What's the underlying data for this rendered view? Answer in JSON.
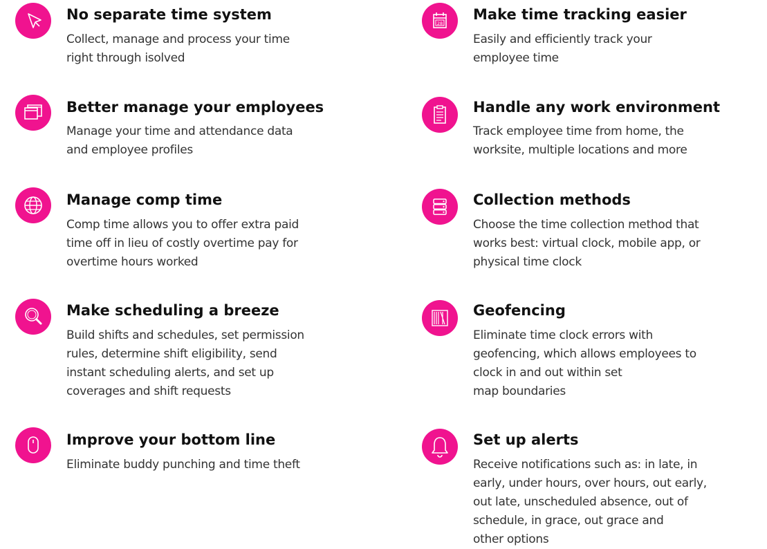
{
  "accent_color": "#f0138f",
  "features": [
    {
      "icon": "cursor-arrow-icon",
      "title": "No separate time system",
      "desc_lines": [
        "Collect, manage and process your time",
        "right through isolved"
      ]
    },
    {
      "icon": "stacked-windows-icon",
      "title": "Better manage your employees",
      "desc_lines": [
        "Manage your time and attendance data",
        "and employee profiles"
      ]
    },
    {
      "icon": "globe-icon",
      "title": "Manage comp time",
      "desc_lines": [
        "Comp time allows you to offer extra paid",
        "time off in lieu of costly overtime pay for",
        "overtime hours worked"
      ]
    },
    {
      "icon": "magnifier-icon",
      "title": "Make scheduling a breeze",
      "desc_lines": [
        "Build shifts and schedules, set permission",
        "rules, determine shift eligibility, send",
        "instant scheduling alerts, and set up",
        "coverages and shift requests"
      ]
    },
    {
      "icon": "mouse-icon",
      "title": "Improve your bottom line",
      "desc_lines": [
        "Eliminate buddy punching and time theft"
      ]
    },
    {
      "icon": "calendar-icon",
      "calendar_day": "28",
      "title": "Make time tracking easier",
      "desc_lines": [
        "Easily and efficiently track your",
        "employee time"
      ]
    },
    {
      "icon": "clipboard-icon",
      "title": "Handle any work environment",
      "desc_lines": [
        "Track employee time from home, the",
        "worksite, multiple locations and more"
      ]
    },
    {
      "icon": "server-icon",
      "title": "Collection methods",
      "desc_lines": [
        "Choose the time collection method that",
        "works best: virtual clock, mobile app, or",
        "physical time clock"
      ]
    },
    {
      "icon": "bookshelf-icon",
      "title": "Geofencing",
      "desc_lines": [
        "Eliminate time clock errors with",
        "geofencing, which allows employees to",
        "clock in and out within set",
        "map boundaries"
      ]
    },
    {
      "icon": "bell-icon",
      "title": "Set up alerts",
      "desc_lines": [
        "Receive notifications such as: in late, in",
        "early, under hours, over hours, out early,",
        "out late, unscheduled absence, out of",
        "schedule, in grace, out grace and",
        "other options"
      ]
    }
  ]
}
